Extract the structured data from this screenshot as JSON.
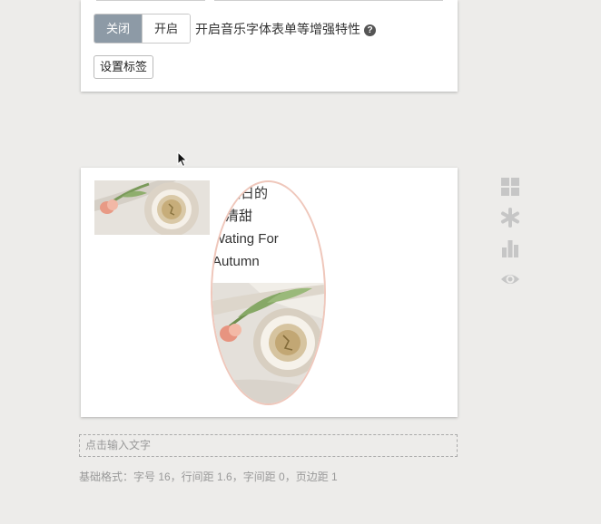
{
  "settings": {
    "toggle_off": "关闭",
    "toggle_on": "开启",
    "toggle_description": "开启音乐字体表单等增强特性",
    "help_glyph": "?",
    "set_label_button": "设置标签"
  },
  "preview": {
    "lines": [
      "秋日的",
      "清甜",
      "Wating For",
      "Autumn"
    ]
  },
  "tools": {
    "icons": [
      "grid-icon",
      "asterisk-icon",
      "bar-chart-icon",
      "eye-icon"
    ],
    "color": "#c6c6c6"
  },
  "editor": {
    "placeholder": "点击输入文字",
    "format_info": "基础格式：字号 16，行间距 1.6，字间距 0，页边距 1"
  },
  "colors": {
    "toggle_active": "#8d9aa6",
    "ellipse_border": "#efc7bb",
    "background": "#edecea"
  }
}
